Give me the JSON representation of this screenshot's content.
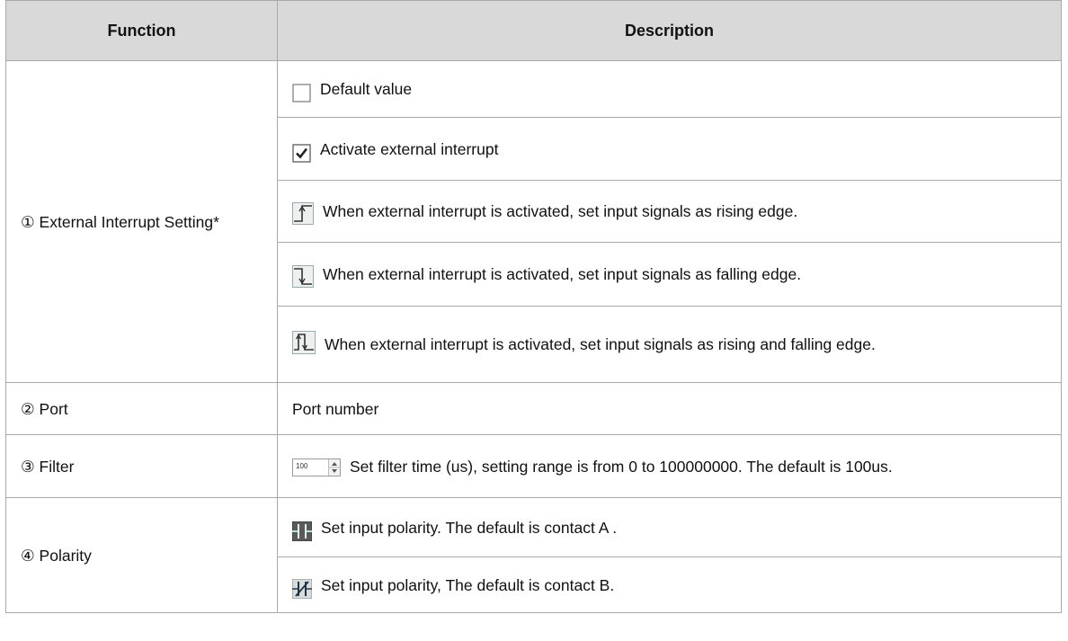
{
  "table": {
    "headers": {
      "function": "Function",
      "description": "Description"
    },
    "groups": {
      "interrupt": {
        "label": "① External Interrupt Setting*"
      },
      "port": {
        "label": "② Port"
      },
      "filter": {
        "label": "③ Filter"
      },
      "polarity": {
        "label": "④ Polarity"
      }
    },
    "rows": {
      "default_value": {
        "icon": "unchecked-box-icon",
        "text": "Default value"
      },
      "activate": {
        "icon": "checked-box-icon",
        "text": "Activate external interrupt"
      },
      "rising": {
        "icon": "rising-edge-icon",
        "text": "When external interrupt is activated, set input signals as rising edge."
      },
      "falling": {
        "icon": "falling-edge-icon",
        "text": "When external interrupt is activated, set input signals as falling edge."
      },
      "both": {
        "icon": "rising-falling-edge-icon",
        "text": "When external interrupt is activated, set input signals as rising and falling edge."
      },
      "port": {
        "text": "Port number"
      },
      "filter": {
        "icon": "filter-spinbox",
        "spin_value": "100",
        "text": "Set filter time (us), setting range is from 0 to 100000000. The default is 100us."
      },
      "polarity_a": {
        "icon": "contact-a-icon",
        "text": "Set input polarity. The default is contact A ."
      },
      "polarity_b": {
        "icon": "contact-b-icon",
        "text": "Set input polarity, The default is contact B."
      }
    }
  },
  "colors": {
    "header_bg": "#d9d9d9",
    "border": "#a9a9a9",
    "icon_dark": "#5a5a5a",
    "icon_light": "#c8c8c8"
  }
}
